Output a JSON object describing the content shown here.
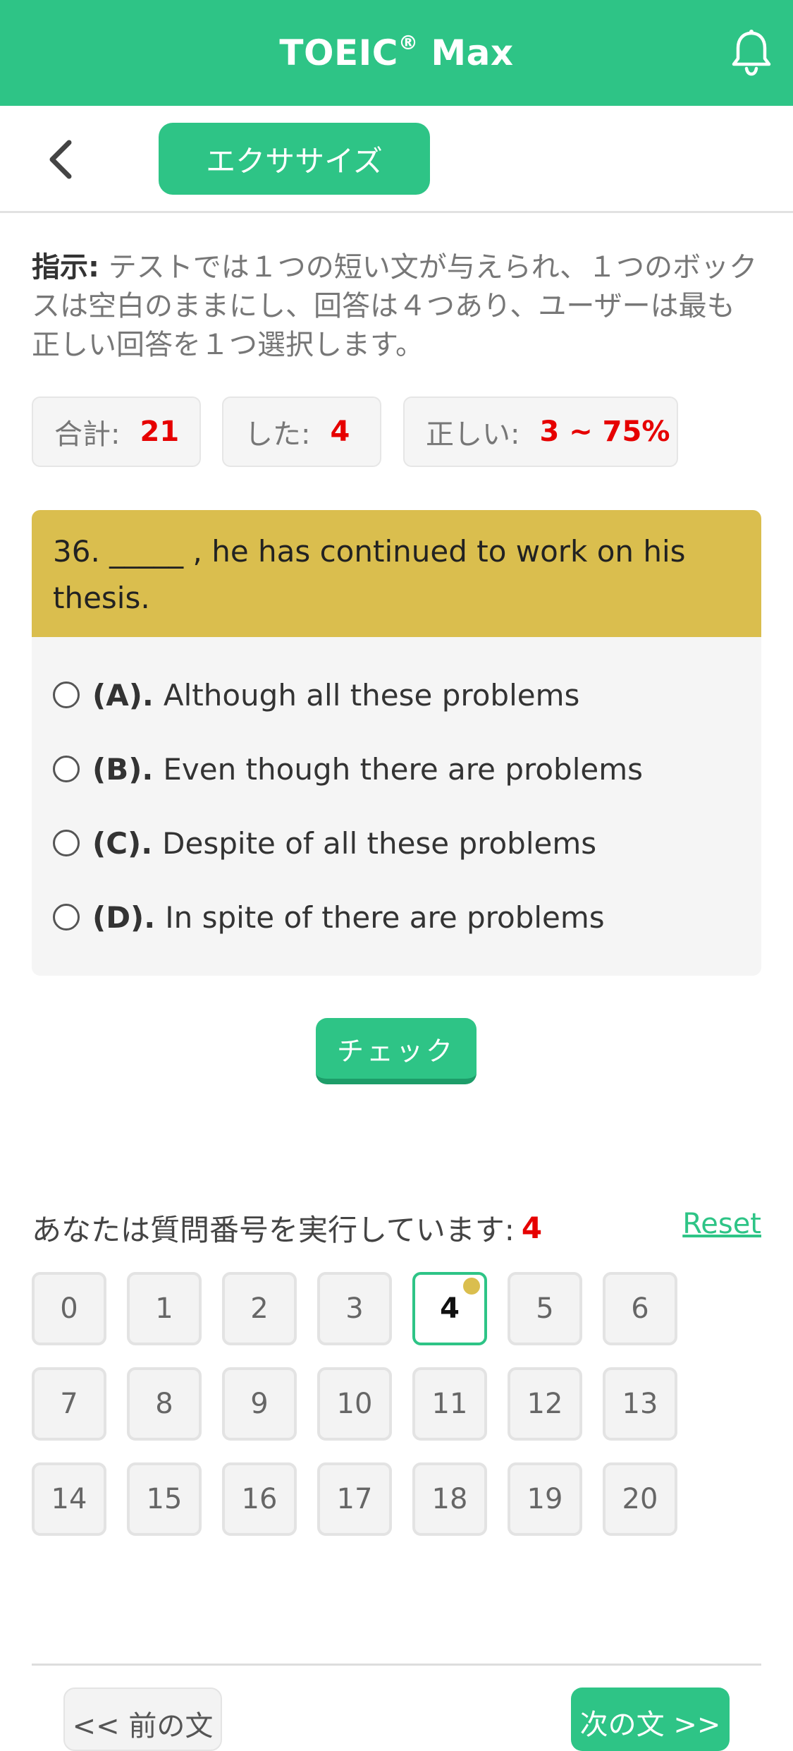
{
  "header": {
    "app_title": "TOEIC",
    "app_title_mark": "®",
    "app_title_suffix": " Max",
    "bell_icon": "bell-icon",
    "brand_color": "#2ec486"
  },
  "subheader": {
    "back_icon": "chevron-left-icon",
    "exercise_label": "エクササイズ"
  },
  "instructions": {
    "label": "指示:",
    "text": " テストでは１つの短い文が与えられ、１つのボックスは空白のままにし、回答は４つあり、ユーザーは最も正しい回答を１つ選択します。"
  },
  "stats": {
    "total_label": "合計:",
    "total_value": "21",
    "done_label": "した:",
    "done_value": "4",
    "correct_label": "正しい:",
    "correct_value": "3 ~ 75%"
  },
  "question": {
    "text_line1": "36. _____ , he has continued to work on his",
    "text_line2": "thesis.",
    "options": [
      {
        "letter": "(A).",
        "text": "Although all these problems"
      },
      {
        "letter": "(B).",
        "text": "Even though there are problems"
      },
      {
        "letter": "(C).",
        "text": "Despite of all these problems"
      },
      {
        "letter": "(D).",
        "text": "In spite of there are problems"
      }
    ]
  },
  "check_label": "チェック",
  "progress": {
    "label": "あなたは質問番号を実行しています:",
    "current": "4",
    "reset_label": "Reset"
  },
  "question_numbers": [
    "0",
    "1",
    "2",
    "3",
    "4",
    "5",
    "6",
    "7",
    "8",
    "9",
    "10",
    "11",
    "12",
    "13",
    "14",
    "15",
    "16",
    "17",
    "18",
    "19",
    "20"
  ],
  "nav": {
    "prev_label": "<< 前の文",
    "next_label": "次の文 >>"
  }
}
